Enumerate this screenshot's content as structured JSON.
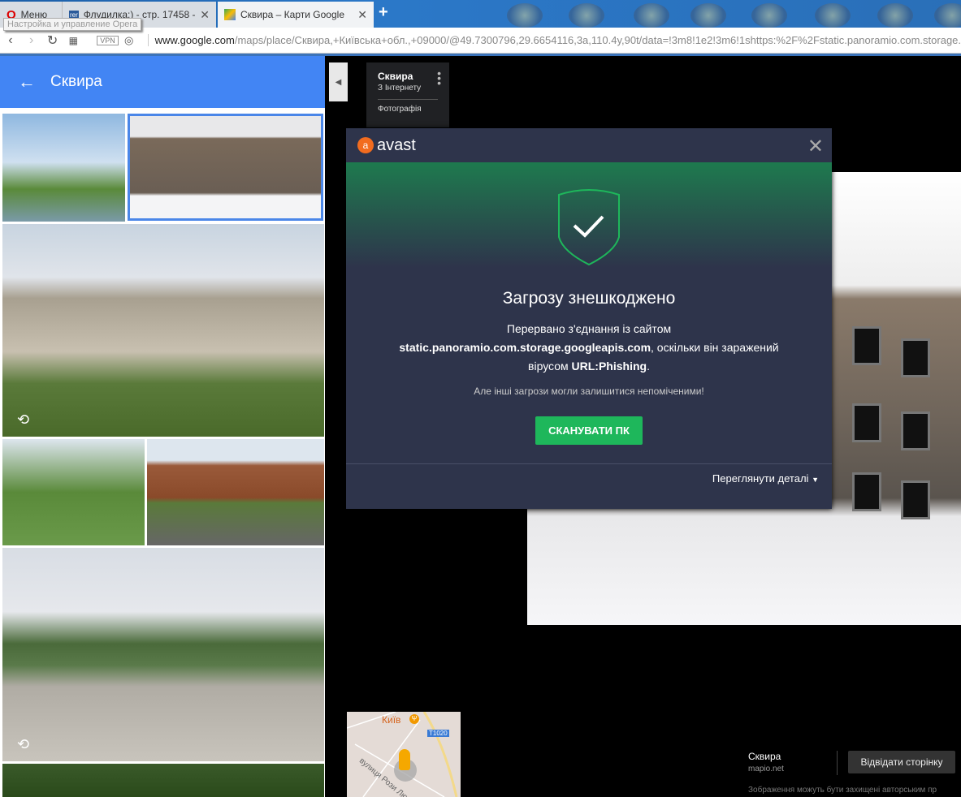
{
  "browser": {
    "menu_label": "Меню",
    "tooltip": "Настройка и управление Opera",
    "tabs": [
      {
        "title": "Флудилка:) - стр. 17458 -"
      },
      {
        "title": "Сквира – Карти Google"
      }
    ],
    "vpn": "VPN",
    "url_host": "www.google.com",
    "url_path": "/maps/place/Сквира,+Київська+обл.,+09000/@49.7300796,29.6654116,3a,110.4y,90t/data=!3m8!1e2!3m6!1shttps:%2F%2Fstatic.panoramio.com.storage."
  },
  "panel": {
    "title": "Сквира"
  },
  "infocard": {
    "name": "Сквира",
    "source": "З Інтернету",
    "type": "Фотографія"
  },
  "avast": {
    "brand": "avast",
    "title": "Загрозу знешкоджено",
    "msg_1": "Перервано з'єднання із сайтом",
    "domain": "static.panoramio.com.storage.googleapis.com",
    "msg_2": ", оскільки він заражений",
    "msg_3": "вірусом ",
    "virus": "URL:Phishing",
    "msg_4": ".",
    "warning": "Але інші загрози могли залишитися непоміченими!",
    "scan_button": "СКАНУВАТИ ПК",
    "details": "Переглянути деталі",
    "colors": {
      "accent": "#1eb75b",
      "bg": "#2e344b"
    }
  },
  "minimap": {
    "city": "Київ",
    "road": "T1020",
    "street": "вулиця Рози Люксе"
  },
  "attribution": {
    "name": "Сквира",
    "source": "mapio.net",
    "visit_button": "Відвідати сторінку",
    "copyright": "Зображення можуть бути захищені авторським пр"
  }
}
